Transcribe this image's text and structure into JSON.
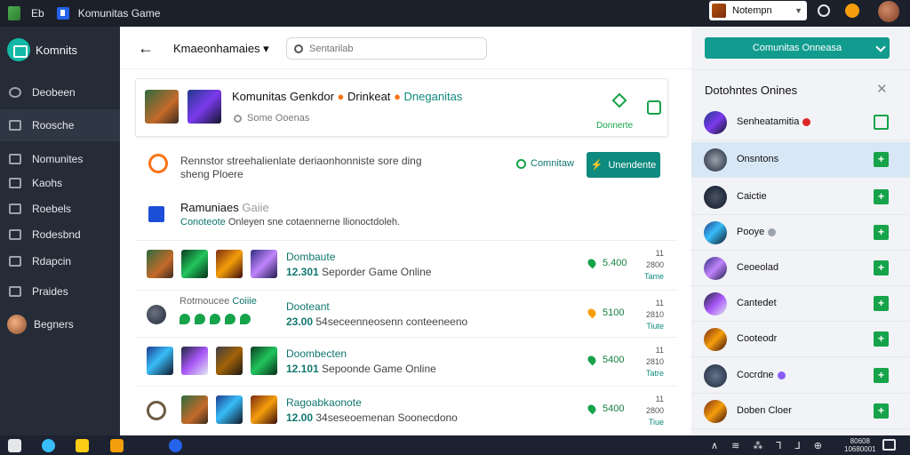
{
  "topbar": {
    "eb_label": "Eb",
    "app_title": "Komunitas Game",
    "user_name": "Notempn"
  },
  "sidebar": {
    "brand": "Komnits",
    "items": [
      {
        "label": "Deobeen",
        "icon": "search-icon"
      },
      {
        "label": "Roosche",
        "icon": "message-icon"
      },
      {
        "label": "Nomunites",
        "icon": "bookmark-icon"
      },
      {
        "label": "Kaohs",
        "icon": "folder-icon"
      },
      {
        "label": "Roebels",
        "icon": "calendar-icon"
      },
      {
        "label": "Rodesbnd",
        "icon": "chat-icon"
      },
      {
        "label": "Rdapcin",
        "icon": "wrench-icon"
      },
      {
        "label": "Praides",
        "icon": "gift-icon"
      },
      {
        "label": "Begners",
        "icon": "user-avatar"
      }
    ]
  },
  "main": {
    "title": "Kmaeonhamaies",
    "search_placeholder": "Sentarilab",
    "featured": {
      "name": "Komunitas Genkdor",
      "tag1": "Drinkeat",
      "tag2": "Dneganitas",
      "subtitle": "Some Ooenas",
      "right_label": "Donnerte"
    },
    "notice": {
      "text": "Rennstor streehalienlate deriaonhonniste sore ding sheng Ploere",
      "link_label": "Comnitaw",
      "button_label": "Unendente"
    },
    "section": {
      "title_a": "Ramuniaes",
      "title_b": "Gaiie",
      "desc_a": "Conoteote",
      "desc_b": "Onleyen sne cotaennerne llionoctdoleh."
    },
    "rows": [
      {
        "name": "Dombaute",
        "count": "12.301",
        "sub": "Seporder Game Online",
        "price": "5.400",
        "meta_a": "11 2800",
        "meta_b": "Tame"
      },
      {
        "left_label": "Rotmoucee",
        "left_label_b": "Coiiie",
        "name": "Dooteant",
        "count": "23.00",
        "sub": "54seceenneosenn conteeneeno",
        "price": "5100",
        "meta_a": "11 2810",
        "meta_b": "Tiute"
      },
      {
        "name": "Doombecten",
        "count": "12.101",
        "sub": "Sepoonde Game Online",
        "price": "5400",
        "meta_a": "11 2810",
        "meta_b": "Tatre"
      },
      {
        "name": "Ragoabkaonote",
        "count": "12.00",
        "sub": "34seseoemenan Soonecdono",
        "price": "5400",
        "meta_a": "11 2800",
        "meta_b": "Tiue"
      }
    ]
  },
  "right_panel": {
    "dropdown_label": "Comunitas Onneasa",
    "title": "Dotohntes Onines",
    "items": [
      {
        "name": "Senheatamitia",
        "badge_color": "#dc2626"
      },
      {
        "name": "Onsntons"
      },
      {
        "name": "Caictie"
      },
      {
        "name": "Pooye",
        "badge_color": "#9ca3af"
      },
      {
        "name": "Ceoeolad"
      },
      {
        "name": "Cantedet"
      },
      {
        "name": "Cooteodr"
      },
      {
        "name": "Cocrdne",
        "badge_color": "#8b5cf6"
      },
      {
        "name": "Doben Cloer"
      }
    ]
  },
  "taskbar": {
    "tray": "∧ ≋ ⁂ ⅂ ⅃ ⊕",
    "time": "80608",
    "date": "10680001"
  }
}
